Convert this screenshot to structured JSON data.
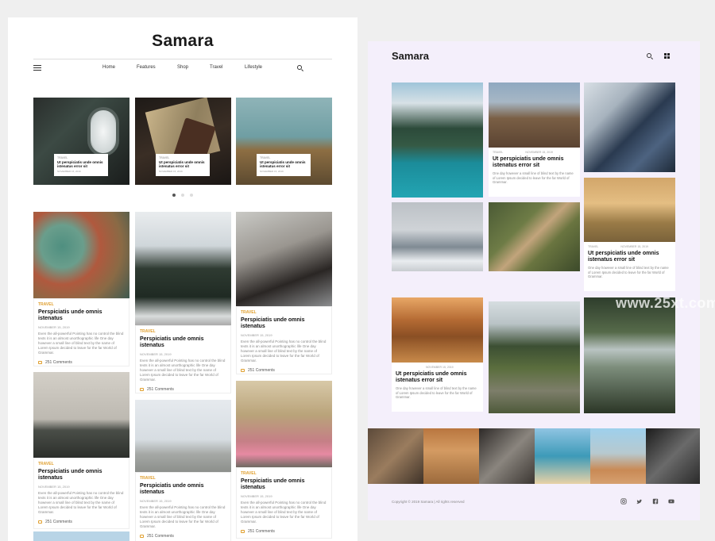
{
  "left": {
    "logo": "Samara",
    "nav": [
      "Home",
      "Features",
      "Shop",
      "Travel",
      "Lifestyle"
    ],
    "slides": [
      {
        "category": "TRAVEL",
        "title": "Ut perspiciatis unde omnis istenatus error sit",
        "date": "NOVEMBER 15, 2019"
      },
      {
        "category": "TRAVEL",
        "title": "Ut perspiciatis unde omnis istenatus error sit",
        "date": "NOVEMBER 15, 2019"
      },
      {
        "category": "TRAVEL",
        "title": "Ut perspiciatis unde omnis istenatus error sit",
        "date": "NOVEMBER 15, 2019"
      }
    ],
    "posts": [
      {
        "category": "TRAVEL",
        "title": "Perspiciatis unde omnis istenatus",
        "date": "NOVEMBER 15, 2019",
        "excerpt": "Even the all-powerful Pointing has no control the blind texts it is an almost unorthographic life One day however a small line of blind text by the name of Lorem Ipsum decided to leave for the far World of Grammar.",
        "comments": "251 Comments"
      },
      {
        "category": "TRAVEL",
        "title": "Perspiciatis unde omnis istenatus",
        "date": "NOVEMBER 15, 2019",
        "excerpt": "Even the all-powerful Pointing has no control the blind texts it is an almost unorthographic life One day however a small line of blind text by the name of Lorem Ipsum decided to leave for the far World of Grammar.",
        "comments": "251 Comments"
      },
      {
        "category": "TRAVEL",
        "title": "Perspiciatis unde omnis istenatus",
        "date": "NOVEMBER 15, 2019",
        "excerpt": "Even the all-powerful Pointing has no control the blind texts it is an almost unorthographic life One day however a small line of blind text by the name of Lorem Ipsum decided to leave for the far World of Grammar.",
        "comments": "251 Comments"
      },
      {
        "category": "TRAVEL",
        "title": "Perspiciatis unde omnis istenatus",
        "date": "NOVEMBER 15, 2019",
        "excerpt": "Even the all-powerful Pointing has no control the blind texts it is an almost unorthographic life One day however a small line of blind text by the name of Lorem Ipsum decided to leave for the far World of Grammar.",
        "comments": "251 Comments"
      },
      {
        "category": "TRAVEL",
        "title": "Perspiciatis unde omnis istenatus",
        "date": "NOVEMBER 15, 2019",
        "excerpt": "Even the all-powerful Pointing has no control the blind texts it is an almost unorthographic life One day however a small line of blind text by the name of Lorem Ipsum decided to leave for the far World of Grammar.",
        "comments": "251 Comments"
      },
      {
        "category": "TRAVEL",
        "title": "Perspiciatis unde omnis istenatus",
        "date": "NOVEMBER 15, 2019",
        "excerpt": "Even the all-powerful Pointing has no control the blind texts it is an almost unorthographic life One day however a small line of blind text by the name of Lorem Ipsum decided to leave for the far World of Grammar.",
        "comments": "251 Comments"
      }
    ],
    "accent": "#e0a030"
  },
  "right": {
    "logo": "Samara",
    "cards": [
      {
        "category": "TRAVEL",
        "date": "NOVEMBER 15, 2019",
        "title": "Ut perspiciatis unde omnis istenatus error sit",
        "excerpt": "One day however a small line of blind text by the name of Lorem Ipsum decided to leave for the far World of Grammar."
      },
      {
        "category": "TRAVEL",
        "date": "NOVEMBER 15, 2019",
        "title": "Ut perspiciatis unde omnis istenatus error sit",
        "excerpt": "One day however a small line of blind text by the name of Lorem Ipsum decided to leave for the far World of Grammar."
      },
      {
        "category": "",
        "date": "NOVEMBER 15, 2019",
        "title": "Ut perspiciatis unde omnis istenatus error sit",
        "excerpt": "One day however a small line of blind text by the name of Lorem Ipsum decided to leave for the far World of Grammar."
      }
    ],
    "footer": "Copyright © 2019 Samara | All rights reserved",
    "social": [
      "instagram-icon",
      "twitter-icon",
      "facebook-icon",
      "youtube-icon"
    ],
    "bg": "#f4effb"
  },
  "watermark": "www.25xt.com"
}
